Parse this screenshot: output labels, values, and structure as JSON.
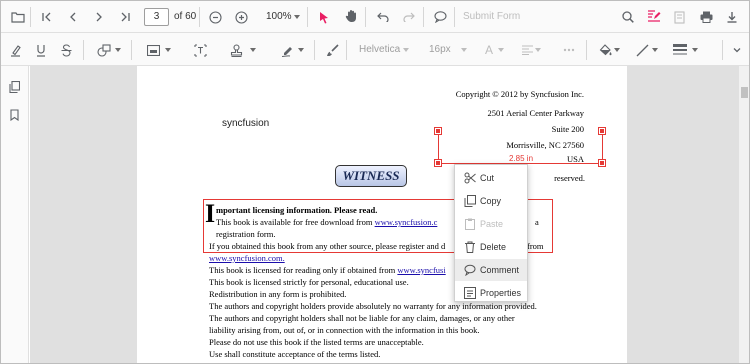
{
  "toolbar": {
    "page_number": "3",
    "page_total": "of 60",
    "zoom": "100%",
    "submit_form": "Submit Form",
    "icons": [
      "open-icon",
      "first-page-icon",
      "previous-page-icon",
      "next-page-icon",
      "last-page-icon",
      "zoom-out-icon",
      "zoom-in-icon",
      "select-cursor-icon",
      "pan-icon",
      "undo-icon",
      "redo-icon",
      "comment-icon",
      "search-icon",
      "annotation-icon",
      "form-designer-icon",
      "print-icon",
      "download-icon"
    ]
  },
  "annotation_toolbar": {
    "font_family": "Helvetica",
    "font_size": "16px",
    "icons": [
      "highlight-icon",
      "underline-icon",
      "strikethrough-icon",
      "shapes-icon",
      "calibrate-icon",
      "free-text-box-icon",
      "stamp-icon",
      "signature-icon",
      "ink-icon",
      "font-color-icon",
      "text-align-icon",
      "text-properties-icon",
      "fill-color-icon",
      "stroke-color-icon",
      "thickness-icon",
      "close-annotation-toolbar-icon"
    ]
  },
  "sidebar": {
    "icons": [
      "page-organizer-icon",
      "bookmark-icon"
    ]
  },
  "document": {
    "copyright": "Copyright © 2012 by Syncfusion Inc.",
    "address": [
      "2501 Aerial Center Parkway",
      "Suite 200",
      "Morrisville, NC 27560",
      "USA"
    ],
    "reserved": "reserved.",
    "logo_text": "syncfusion",
    "stamp": "WITNESS",
    "measure_label": "2.85 in",
    "dropcap": "I",
    "notice_heading": "mportant licensing information. Please read.",
    "notice_line1": "This book is available for free download from",
    "notice_link1": "www.syncfusion.c",
    "notice_line1_end": "a",
    "notice_line2": "registration form.",
    "notice_line3": "If you obtained this book from any other source, please register and d",
    "notice_line3_end": "from",
    "link_line": "www.syncfusion.com.",
    "body_line1": "This book is licensed for reading only if obtained from",
    "body_link1": "www.syncfusi",
    "body_lines": [
      "This book is licensed strictly for personal, educational use.",
      "Redistribution in any form is prohibited.",
      "The authors and copyright holders provide absolutely no warranty for any information provided.",
      "The authors and copyright holders shall not be liable for any claim, damages, or any other",
      "liability arising from, out of, or in connection with the information in this book.",
      "Please do not use this book if the listed terms are unacceptable.",
      "Use shall constitute acceptance of the terms listed."
    ]
  },
  "context_menu": {
    "items": [
      {
        "label": "Cut",
        "icon": "cut-icon",
        "state": "enabled"
      },
      {
        "label": "Copy",
        "icon": "copy-icon",
        "state": "enabled"
      },
      {
        "label": "Paste",
        "icon": "paste-icon",
        "state": "disabled"
      },
      {
        "label": "Delete",
        "icon": "delete-icon",
        "state": "enabled"
      },
      {
        "label": "Comment",
        "icon": "comment-icon",
        "state": "hovered"
      },
      {
        "label": "Properties",
        "icon": "properties-icon",
        "state": "enabled"
      }
    ]
  },
  "colors": {
    "accent": "#e91e63",
    "selection": "#e53935",
    "toolbar_bg": "#fafafa",
    "viewport_bg": "#e0e0e0"
  }
}
